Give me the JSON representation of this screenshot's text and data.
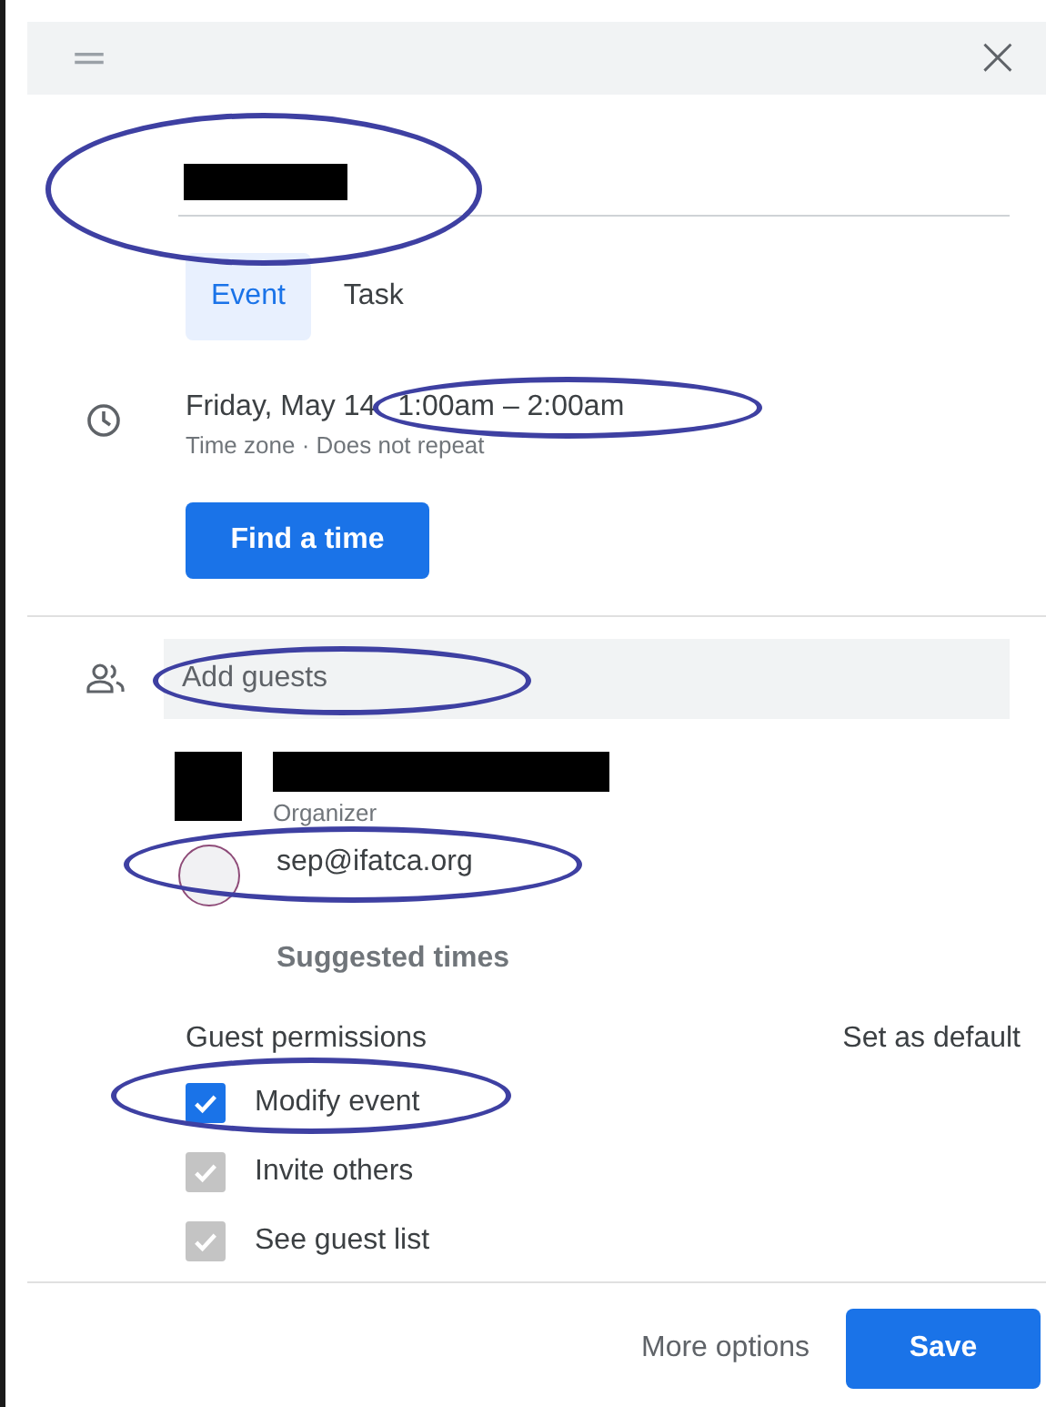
{
  "header": {
    "close": "×"
  },
  "title": {
    "redacted": true,
    "circled": true
  },
  "tabs": [
    {
      "label": "Event",
      "selected": true
    },
    {
      "label": "Task",
      "selected": false
    }
  ],
  "when": {
    "date": "Friday, May 14",
    "time": "1:00am  –  2:00am",
    "time_circled": true,
    "details": "Time zone · Does not repeat"
  },
  "find_time_button": "Find a time",
  "guests_field": {
    "placeholder": "Add guests",
    "circled": true
  },
  "guests": [
    {
      "kind": "redacted",
      "role": "Organizer",
      "circled": false
    },
    {
      "kind": "person",
      "email": "sep@ifatca.org",
      "circled": true
    }
  ],
  "suggested_times": "Suggested times",
  "permissions": {
    "heading": "Guest permissions",
    "set_default": "Set as default",
    "items": [
      {
        "label": "Modify event",
        "checked": true,
        "disabled": false,
        "circled": true
      },
      {
        "label": "Invite others",
        "checked": true,
        "disabled": true,
        "circled": false
      },
      {
        "label": "See guest list",
        "checked": true,
        "disabled": true,
        "circled": false
      }
    ]
  },
  "footer": {
    "more_options": "More options",
    "save": "Save"
  }
}
